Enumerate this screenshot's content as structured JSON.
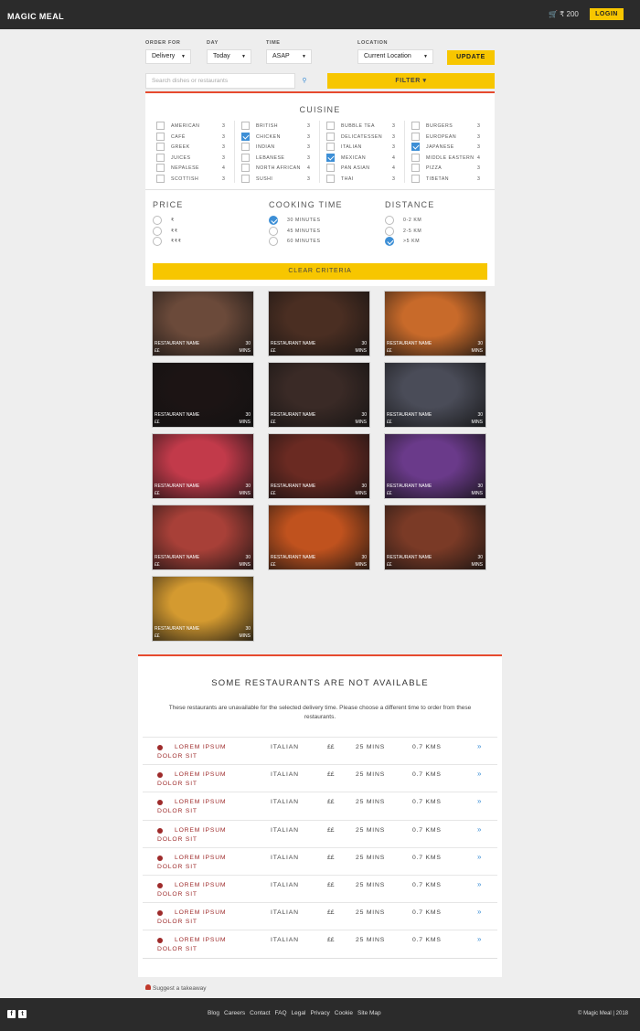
{
  "header": {
    "brand": "MAGIC MEAL",
    "basket": "🛒 ₹ 200",
    "login": "LOGIN"
  },
  "controls": {
    "order_for_label": "ORDER FOR",
    "order_for_value": "Delivery",
    "day_label": "DAY",
    "day_value": "Today",
    "time_label": "TIME",
    "time_value": "ASAP",
    "location_label": "LOCATION",
    "location_value": "Current Location",
    "update": "UPDATE",
    "search_placeholder": "Search dishes or restaurants",
    "filter": "FILTER ▾"
  },
  "cuisine": {
    "title": "CUISINE",
    "items": [
      {
        "name": "AMERICAN",
        "count": "3",
        "checked": false
      },
      {
        "name": "CAFÉ",
        "count": "3",
        "checked": false
      },
      {
        "name": "GREEK",
        "count": "3",
        "checked": false
      },
      {
        "name": "JUICES",
        "count": "3",
        "checked": false
      },
      {
        "name": "NEPALESE",
        "count": "4",
        "checked": false
      },
      {
        "name": "SCOTTISH",
        "count": "3",
        "checked": false
      },
      {
        "name": "BRITISH",
        "count": "3",
        "checked": false
      },
      {
        "name": "CHICKEN",
        "count": "3",
        "checked": true
      },
      {
        "name": "INDIAN",
        "count": "3",
        "checked": false
      },
      {
        "name": "LEBANESE",
        "count": "3",
        "checked": false
      },
      {
        "name": "NORTH AFRICAN",
        "count": "4",
        "checked": false
      },
      {
        "name": "SUSHI",
        "count": "3",
        "checked": false
      },
      {
        "name": "BUBBLE TEA",
        "count": "3",
        "checked": false
      },
      {
        "name": "DELICATESSEN",
        "count": "3",
        "checked": false
      },
      {
        "name": "ITALIAN",
        "count": "3",
        "checked": false
      },
      {
        "name": "MEXICAN",
        "count": "4",
        "checked": true
      },
      {
        "name": "PAN ASIAN",
        "count": "4",
        "checked": false
      },
      {
        "name": "THAI",
        "count": "3",
        "checked": false
      },
      {
        "name": "BURGERS",
        "count": "3",
        "checked": false
      },
      {
        "name": "EUROPEAN",
        "count": "3",
        "checked": false
      },
      {
        "name": "JAPANESE",
        "count": "3",
        "checked": true
      },
      {
        "name": "MIDDLE EASTERN",
        "count": "4",
        "checked": false
      },
      {
        "name": "PIZZA",
        "count": "3",
        "checked": false
      },
      {
        "name": "TIBETAN",
        "count": "3",
        "checked": false
      }
    ]
  },
  "price": {
    "title": "PRICE",
    "options": [
      {
        "label": "₹",
        "checked": false
      },
      {
        "label": "₹₹",
        "checked": false
      },
      {
        "label": "₹₹₹",
        "checked": false
      }
    ]
  },
  "cooking": {
    "title": "COOKING TIME",
    "options": [
      {
        "label": "30 MINUTES",
        "checked": true
      },
      {
        "label": "45 MINUTES",
        "checked": false
      },
      {
        "label": "60 MINUTES",
        "checked": false
      }
    ]
  },
  "distance": {
    "title": "DISTANCE",
    "options": [
      {
        "label": "0-2 KM",
        "checked": false
      },
      {
        "label": "2-5 KM",
        "checked": false
      },
      {
        "label": ">5 KM",
        "checked": true
      }
    ]
  },
  "clear": "CLEAR CRITERIA",
  "tiles": [
    {
      "name": "RESTAURANT NAME",
      "price": "££",
      "time": "30",
      "unit": "MINS",
      "color": "#6b4a3a"
    },
    {
      "name": "RESTAURANT NAME",
      "price": "££",
      "time": "30",
      "unit": "MINS",
      "color": "#4a2e22"
    },
    {
      "name": "RESTAURANT NAME",
      "price": "££",
      "time": "30",
      "unit": "MINS",
      "color": "#c86a2a"
    },
    {
      "name": "RESTAURANT NAME",
      "price": "££",
      "time": "30",
      "unit": "MINS",
      "color": "#1c1414"
    },
    {
      "name": "RESTAURANT NAME",
      "price": "££",
      "time": "30",
      "unit": "MINS",
      "color": "#3a2a26"
    },
    {
      "name": "RESTAURANT NAME",
      "price": "££",
      "time": "30",
      "unit": "MINS",
      "color": "#4a4c58"
    },
    {
      "name": "RESTAURANT NAME",
      "price": "££",
      "time": "30",
      "unit": "MINS",
      "color": "#c23a4a"
    },
    {
      "name": "RESTAURANT NAME",
      "price": "££",
      "time": "30",
      "unit": "MINS",
      "color": "#6a2a22"
    },
    {
      "name": "RESTAURANT NAME",
      "price": "££",
      "time": "30",
      "unit": "MINS",
      "color": "#6a3a8a"
    },
    {
      "name": "RESTAURANT NAME",
      "price": "££",
      "time": "30",
      "unit": "MINS",
      "color": "#a84038"
    },
    {
      "name": "RESTAURANT NAME",
      "price": "££",
      "time": "30",
      "unit": "MINS",
      "color": "#c0521e"
    },
    {
      "name": "RESTAURANT NAME",
      "price": "££",
      "time": "30",
      "unit": "MINS",
      "color": "#7a3a26"
    },
    {
      "name": "RESTAURANT NAME",
      "price": "££",
      "time": "30",
      "unit": "MINS",
      "color": "#d49a30"
    }
  ],
  "unavailable": {
    "title": "SOME RESTAURANTS ARE NOT AVAILABLE",
    "desc": "These restaurants are unavailable for the selected delivery time. Please choose a different time to order from these restaurants.",
    "rows": [
      {
        "name": "LOREM IPSUM DOLOR SIT",
        "cuisine": "ITALIAN",
        "price": "££",
        "time": "25 MINS",
        "dist": "0.7 KMS",
        "go": "»"
      },
      {
        "name": "LOREM IPSUM DOLOR SIT",
        "cuisine": "ITALIAN",
        "price": "££",
        "time": "25 MINS",
        "dist": "0.7 KMS",
        "go": "»"
      },
      {
        "name": "LOREM IPSUM DOLOR SIT",
        "cuisine": "ITALIAN",
        "price": "££",
        "time": "25 MINS",
        "dist": "0.7 KMS",
        "go": "»"
      },
      {
        "name": "LOREM IPSUM DOLOR SIT",
        "cuisine": "ITALIAN",
        "price": "££",
        "time": "25 MINS",
        "dist": "0.7 KMS",
        "go": "»"
      },
      {
        "name": "LOREM IPSUM DOLOR SIT",
        "cuisine": "ITALIAN",
        "price": "££",
        "time": "25 MINS",
        "dist": "0.7 KMS",
        "go": "»"
      },
      {
        "name": "LOREM IPSUM DOLOR SIT",
        "cuisine": "ITALIAN",
        "price": "££",
        "time": "25 MINS",
        "dist": "0.7 KMS",
        "go": "»"
      },
      {
        "name": "LOREM IPSUM DOLOR SIT",
        "cuisine": "ITALIAN",
        "price": "££",
        "time": "25 MINS",
        "dist": "0.7 KMS",
        "go": "»"
      },
      {
        "name": "LOREM IPSUM DOLOR SIT",
        "cuisine": "ITALIAN",
        "price": "££",
        "time": "25 MINS",
        "dist": "0.7 KMS",
        "go": "»"
      }
    ]
  },
  "suggest": "Suggest a takeaway",
  "footer": {
    "links": [
      "Blog",
      "Careers",
      "Contact",
      "FAQ",
      "Legal",
      "Privacy",
      "Cookie",
      "Site Map"
    ],
    "copyright": "© Magic Meal | 2018"
  }
}
